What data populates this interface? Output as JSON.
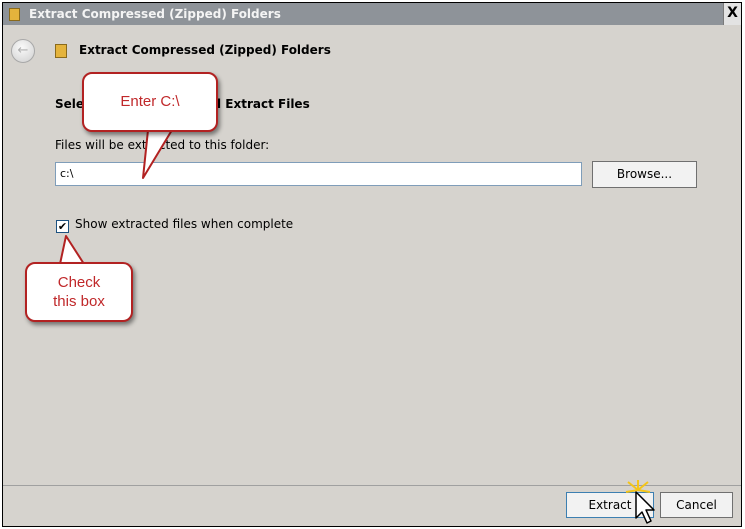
{
  "window": {
    "title": "Extract Compressed (Zipped) Folders",
    "close_label": "X"
  },
  "header": {
    "back_glyph": "←",
    "title": "Extract Compressed (Zipped) Folders"
  },
  "form": {
    "section_title": "Select a Destination and Extract Files",
    "folder_label": "Files will be extracted to this folder:",
    "path_value": "c:\\",
    "browse_label": "Browse...",
    "checkbox_checked": true,
    "checkbox_mark": "✔",
    "checkbox_label": "Show extracted files when complete"
  },
  "footer": {
    "extract_label": "Extract",
    "cancel_label": "Cancel"
  },
  "annotations": {
    "enter_callout": "Enter C:\\",
    "check_callout": "Check this box"
  },
  "colors": {
    "callout_border": "#b22222",
    "callout_text": "#c0282a",
    "dialog_bg": "#d6d3ce",
    "cursor_highlight": "#f5c518"
  },
  "icons": {
    "title": "folder-zip-icon",
    "header": "folder-zip-icon",
    "back": "back-arrow-icon",
    "cursor": "mouse-pointer-icon"
  }
}
